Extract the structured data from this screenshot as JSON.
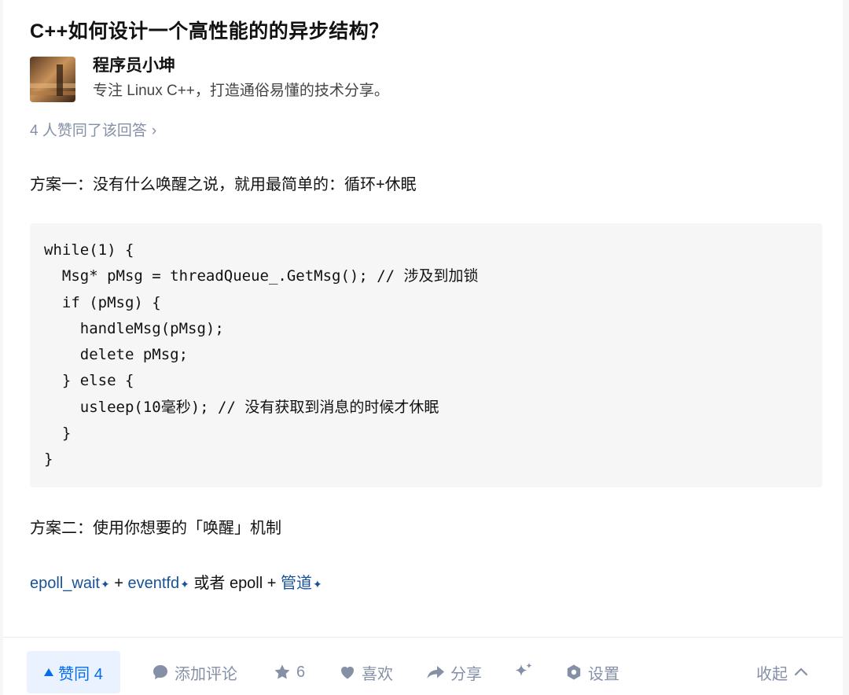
{
  "question": {
    "title": "C++如何设计一个高性能的的异步结构？"
  },
  "author": {
    "name": "程序员小坤",
    "bio": "专注 Linux C++，打造通俗易懂的技术分享。"
  },
  "voters": {
    "text": "4 人赞同了该回答",
    "chevron": "›"
  },
  "answer": {
    "para1": "方案一：没有什么唤醒之说，就用最简单的：循环+休眠",
    "code": [
      "while(1) {",
      "  Msg* pMsg = threadQueue_.GetMsg(); // 涉及到加锁",
      "  if (pMsg) {",
      "    handleMsg(pMsg);",
      "    delete pMsg;",
      "  } else {",
      "    usleep(10毫秒); // 没有获取到消息的时候才休眠",
      "  }",
      "}"
    ],
    "para2": "方案二：使用你想要的「唤醒」机制",
    "para3": {
      "link1": "epoll_wait",
      "plus1": " + ",
      "link2": "eventfd",
      "mid": " 或者 epoll + ",
      "link3": "管道",
      "star": "✦"
    }
  },
  "actions": {
    "vote_label": "赞同 4",
    "comment_label": "添加评论",
    "favorite_count": "6",
    "like_label": "喜欢",
    "share_label": "分享",
    "settings_label": "设置",
    "collapse_label": "收起"
  },
  "colors": {
    "link": "#175199",
    "accent": "#056de8",
    "muted": "#8590a6",
    "vote_bg": "#eaf2ff",
    "code_bg": "#f6f6f6"
  }
}
